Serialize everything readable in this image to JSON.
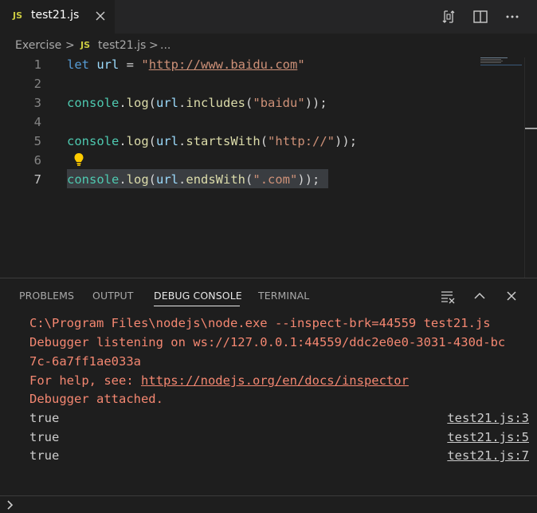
{
  "tab": {
    "badge": "JS",
    "title": "test21.js"
  },
  "breadcrumb": {
    "folder": "Exercise",
    "sep1": ">",
    "badge": "JS",
    "file": "test21.js",
    "sep2": ">",
    "more": "..."
  },
  "editor": {
    "line_numbers": [
      "1",
      "2",
      "3",
      "4",
      "5",
      "6",
      "7"
    ],
    "lines": [
      [
        "let",
        " ",
        "url",
        " = ",
        "\"",
        "http://www.baidu.com",
        "\""
      ],
      [],
      [
        "console",
        ".",
        "log",
        "(",
        "url",
        ".",
        "includes",
        "(",
        "\"baidu\"",
        "));"
      ],
      [],
      [
        "console",
        ".",
        "log",
        "(",
        "url",
        ".",
        "startsWith",
        "(",
        "\"http://\"",
        "));"
      ],
      [],
      [
        "console",
        ".",
        "log",
        "(",
        "url",
        ".",
        "endsWith",
        "(",
        "\".com\"",
        "));"
      ]
    ]
  },
  "panel": {
    "tabs": [
      "PROBLEMS",
      "OUTPUT",
      "DEBUG CONSOLE",
      "TERMINAL"
    ],
    "active_tab": "DEBUG CONSOLE"
  },
  "console": {
    "cmd": "C:\\Program Files\\nodejs\\node.exe --inspect-brk=44559 test21.js",
    "listening_1": "Debugger listening on ws://127.0.0.1:44559/ddc2e0e0-3031-430d-bc",
    "listening_2": "7c-6a7ff1ae033a",
    "help_prefix": "For help, see: ",
    "help_link": "https://nodejs.org/en/docs/inspector",
    "attached": "Debugger attached.",
    "results": [
      {
        "value": "true",
        "source": "test21.js:3"
      },
      {
        "value": "true",
        "source": "test21.js:5"
      },
      {
        "value": "true",
        "source": "test21.js:7"
      }
    ]
  },
  "colors": {
    "background": "#1e1e1e",
    "keyword": "#569cd6",
    "variable": "#9cdcfe",
    "function": "#dcdcaa",
    "string": "#ce9178",
    "console_orange": "#f48771"
  },
  "icons": {
    "tab_close": "close-icon",
    "compare": "compare-changes-icon",
    "split": "split-editor-icon",
    "more": "more-actions-icon",
    "lightbulb": "lightbulb-icon",
    "clear": "clear-console-icon",
    "maximize": "chevron-up-icon",
    "close_panel": "close-icon",
    "prompt": "chevron-right-icon"
  }
}
